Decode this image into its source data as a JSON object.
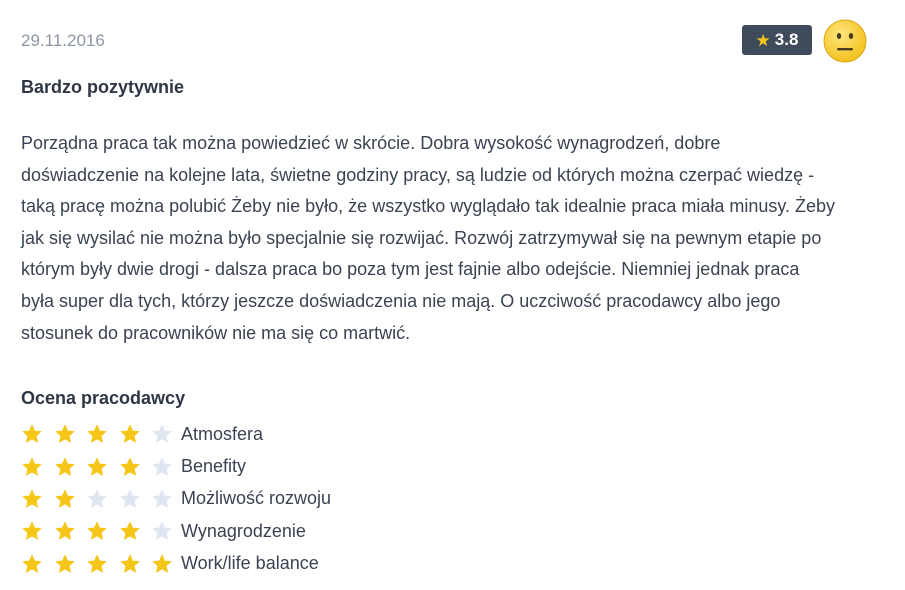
{
  "review": {
    "date": "29.11.2016",
    "overall_rating": "3.8",
    "mood": "neutral-face",
    "title": "Bardzo pozytywnie",
    "lines": [
      "Porządna praca tak można powiedzieć w skrócie. Dobra wysokość wynagrodzeń, dobre",
      "doświadczenie na kolejne lata, świetne godziny pracy, są ludzie od których można czerpać wiedzę -",
      "taką pracę można polubić Żeby nie było, że wszystko wyglądało tak idealnie praca miała minusy. Żeby",
      "jak się wysilać nie można było specjalnie się rozwijać. Rozwój zatrzymywał się na pewnym etapie po",
      "którym były dwie drogi - dalsza praca bo poza tym jest fajnie albo odejście. Niemniej jednak praca",
      "była super dla tych, którzy jeszcze doświadczenia nie mają. O uczciwość pracodawcy albo jego",
      "stosunek do pracowników nie ma się co martwić."
    ]
  },
  "employer_rating": {
    "title": "Ocena pracodawcy",
    "max_stars": 5,
    "items": [
      {
        "label": "Atmosfera",
        "stars": 4
      },
      {
        "label": "Benefity",
        "stars": 4
      },
      {
        "label": "Możliwość rozwoju",
        "stars": 2
      },
      {
        "label": "Wynagrodzenie",
        "stars": 4
      },
      {
        "label": "Work/life balance",
        "stars": 5
      }
    ]
  },
  "colors": {
    "star_filled": "#f5c518",
    "star_empty": "#dfe6f0",
    "badge_bg": "#3f4a5a",
    "text": "#3b4352",
    "muted": "#8d96a5"
  }
}
